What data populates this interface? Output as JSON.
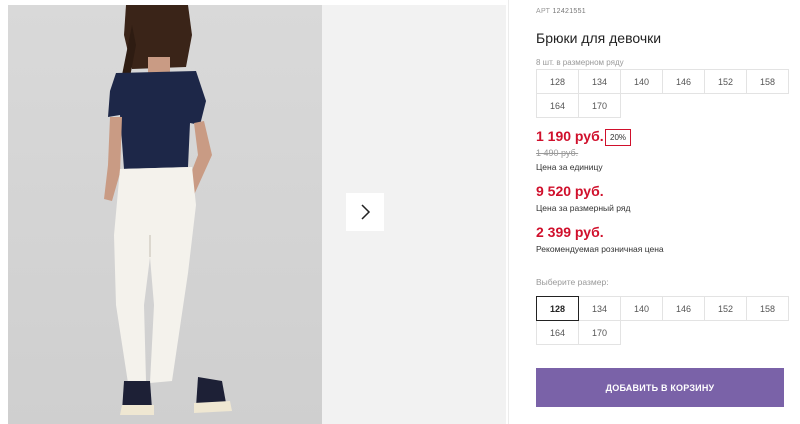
{
  "product": {
    "art_label": "АРТ",
    "art_number": "12421551",
    "title": "Брюки для девочки",
    "row_hint": "8 шт. в размерном ряду",
    "row_sizes": [
      "128",
      "134",
      "140",
      "146",
      "152",
      "158",
      "164",
      "170"
    ],
    "price": "1 190 руб.",
    "discount": "20%",
    "old_price": "1 490 руб.",
    "unit_caption": "Цена за единицу",
    "row_price": "9 520 руб.",
    "row_caption": "Цена за размерный ряд",
    "rrp_price": "2 399 руб.",
    "rrp_caption": "Рекомендуемая розничная цена",
    "choose_label": "Выберите размер:",
    "choose_sizes": [
      "128",
      "134",
      "140",
      "146",
      "152",
      "158",
      "164",
      "170"
    ],
    "selected_size": "128",
    "cart_button": "ДОБАВИТЬ В КОРЗИНУ"
  },
  "colors": {
    "price_red": "#d0102c",
    "cart_purple": "#7a62a8"
  },
  "icons": {
    "next": "chevron-right-icon"
  }
}
